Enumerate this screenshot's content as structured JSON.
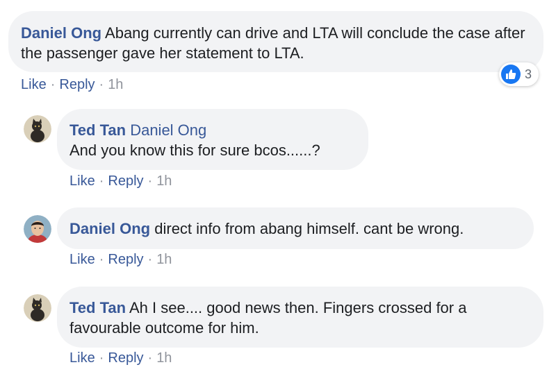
{
  "comments": [
    {
      "author": "Daniel Ong",
      "text": "Abang currently can drive and LTA will conclude the case after the passenger gave her statement to LTA.",
      "like": "Like",
      "reply": "Reply",
      "time": "1h",
      "reaction_count": "3"
    },
    {
      "author": "Ted Tan",
      "mention": "Daniel Ong",
      "text": "And you know this for sure bcos......?",
      "like": "Like",
      "reply": "Reply",
      "time": "1h"
    },
    {
      "author": "Daniel Ong",
      "text": "direct info from abang himself. cant be wrong.",
      "like": "Like",
      "reply": "Reply",
      "time": "1h"
    },
    {
      "author": "Ted Tan",
      "text": "Ah I see.... good news then. Fingers crossed for a favourable outcome for him.",
      "like": "Like",
      "reply": "Reply",
      "time": "1h"
    }
  ],
  "separator": "·",
  "colors": {
    "link": "#385898",
    "bubble": "#f2f3f5",
    "like_blue": "#1877f2",
    "meta": "#90949c"
  },
  "icons": {
    "reaction": "thumbs-up-icon",
    "avatar_ted": "cat-avatar",
    "avatar_daniel": "person-avatar"
  }
}
